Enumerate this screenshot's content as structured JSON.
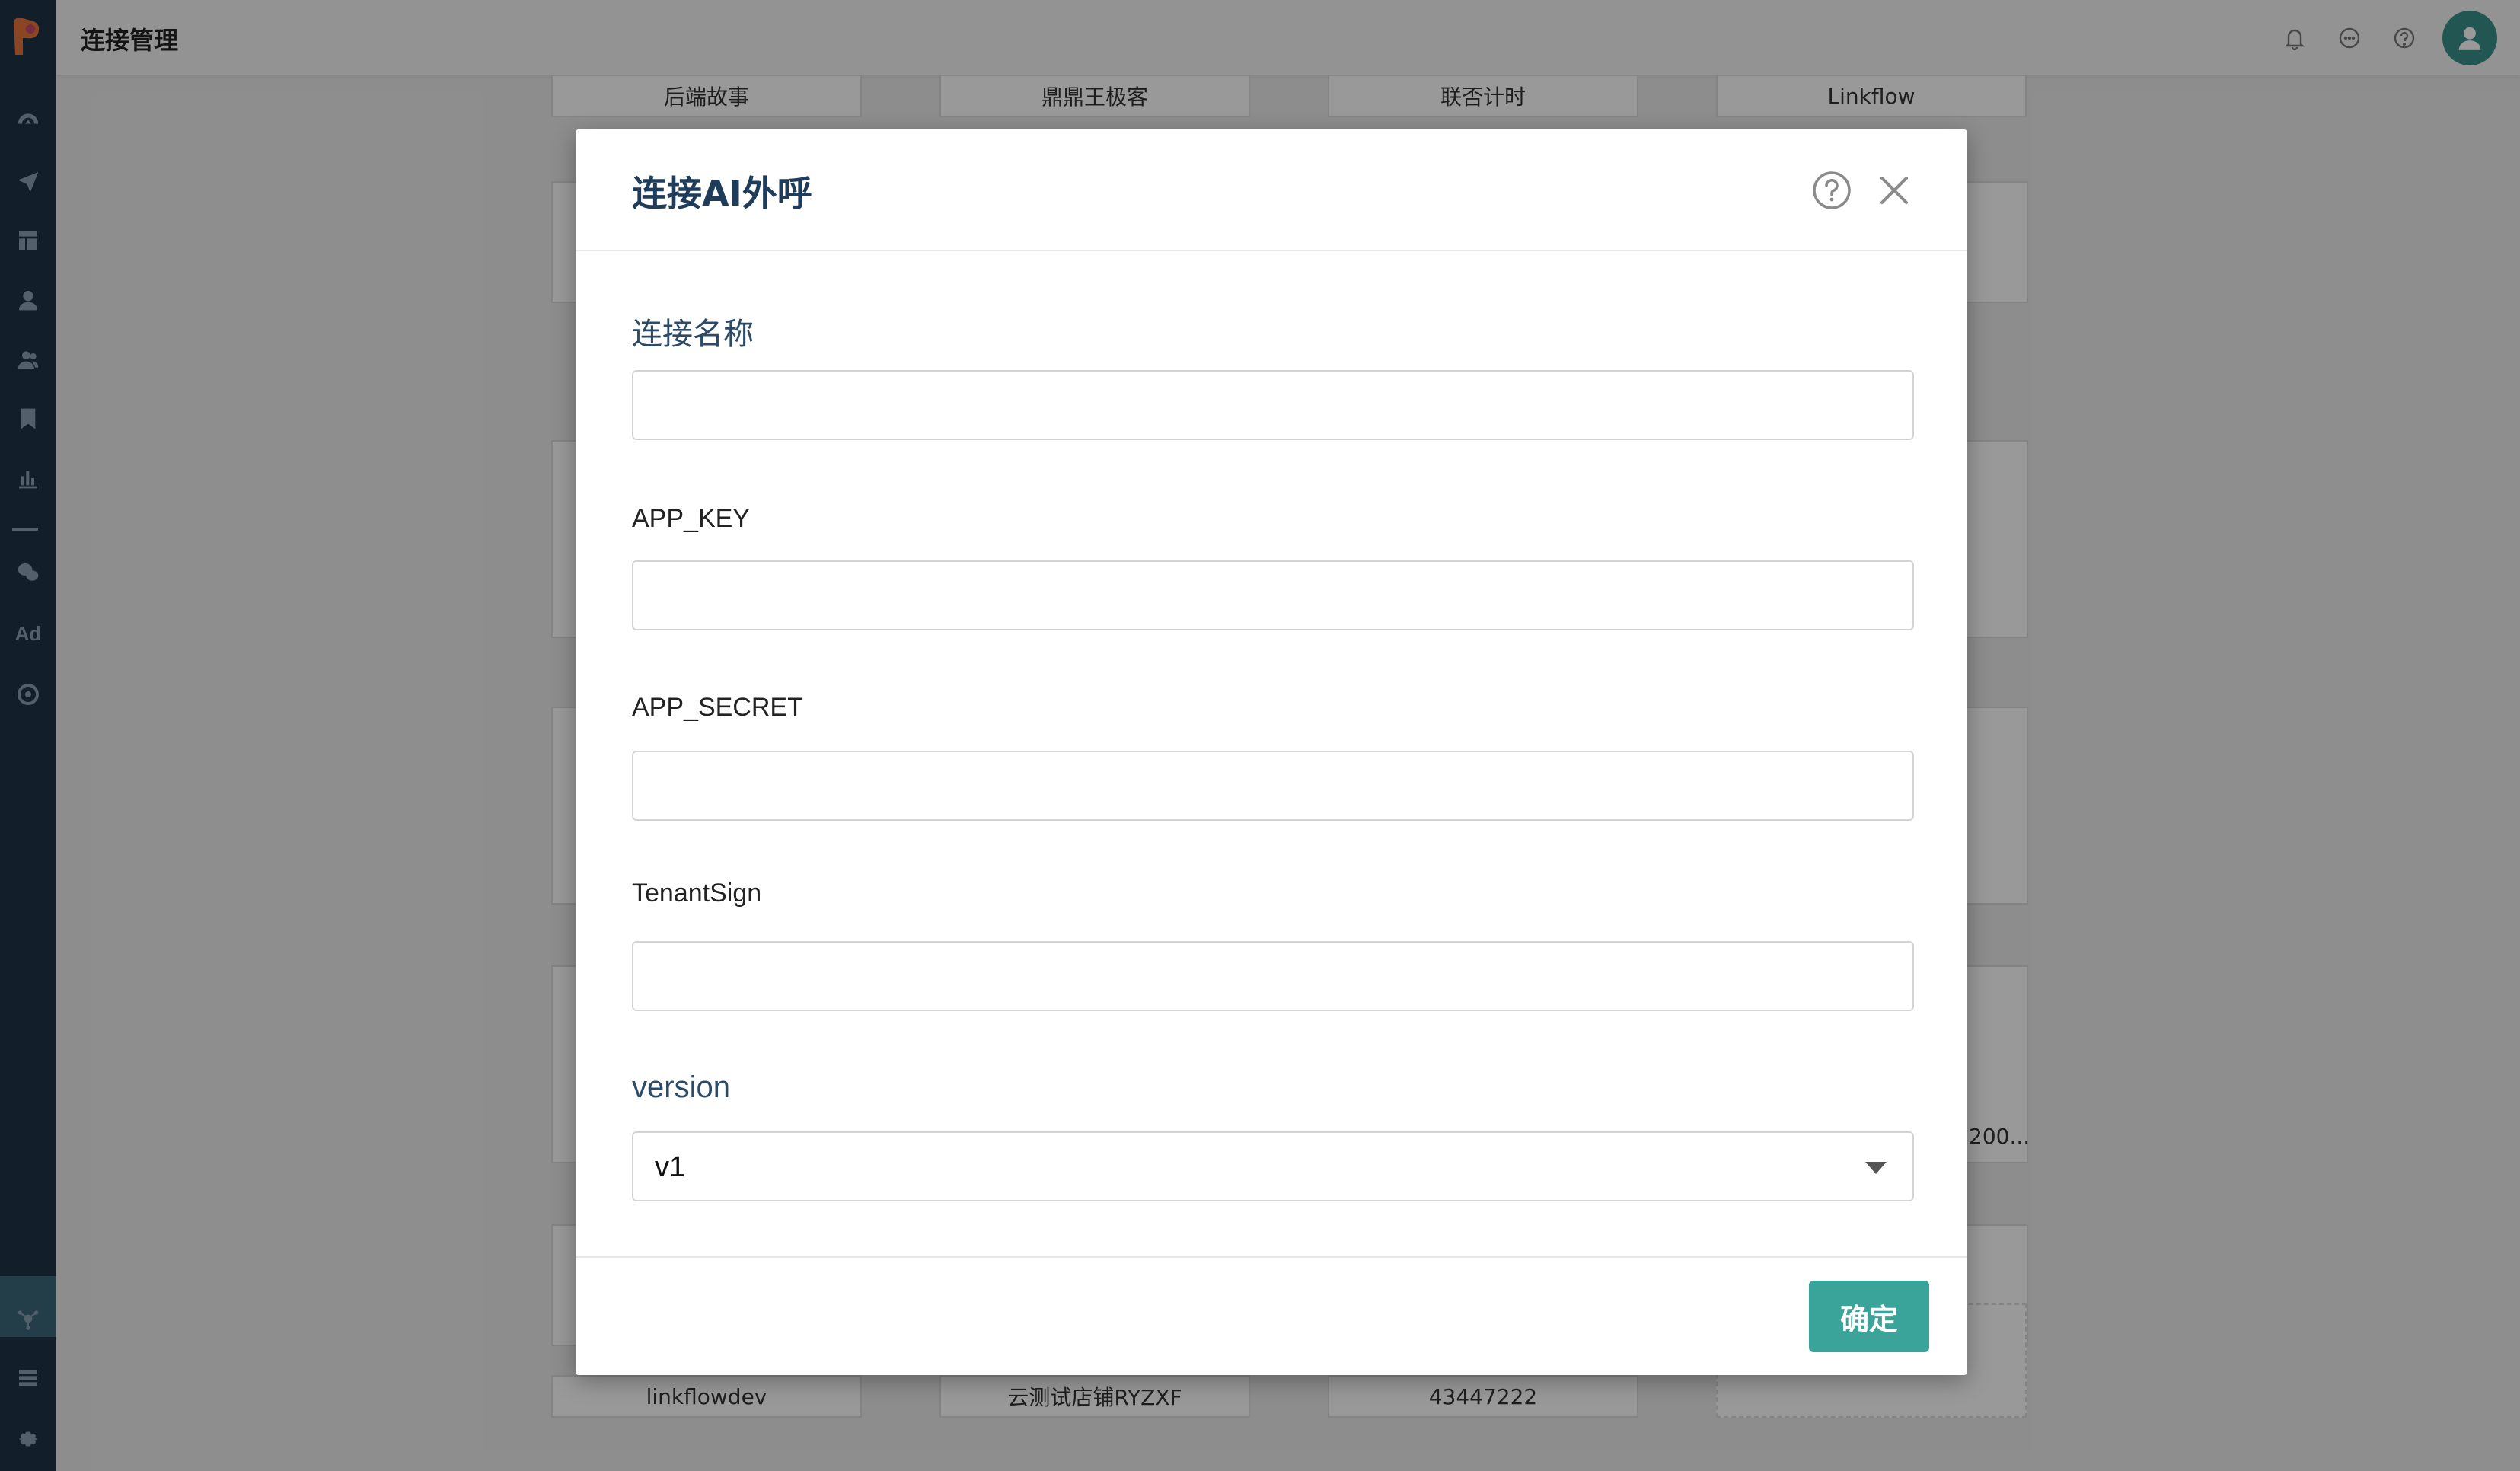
{
  "header": {
    "title": "连接管理",
    "icons": [
      "bell-icon",
      "message-icon",
      "help-icon",
      "user-avatar"
    ]
  },
  "sidebar": {
    "icons": [
      "dashboard-icon",
      "send-icon",
      "layout-icon",
      "user-icon",
      "users-icon",
      "bookmark-icon",
      "bar-chart-icon",
      "wechat-icon",
      "ad-icon",
      "target-icon",
      "connection-icon",
      "list-icon",
      "settings-icon"
    ],
    "ad_label": "Ad"
  },
  "background": {
    "top_tabs": [
      "后端故事",
      "鼎鼎王极客",
      "联否计时",
      "Linkflow"
    ],
    "bottom_tabs": [
      "linkflowdev",
      "云测试店铺RYZXF",
      "43447222"
    ],
    "partial_text": "200..."
  },
  "modal": {
    "title": "连接AI外呼",
    "fields": [
      {
        "label": "连接名称",
        "value": "",
        "placeholder": ""
      },
      {
        "label": "APP_KEY",
        "value": "",
        "placeholder": ""
      },
      {
        "label": "APP_SECRET",
        "value": "",
        "placeholder": ""
      },
      {
        "label": "TenantSign",
        "value": "",
        "placeholder": ""
      }
    ],
    "version": {
      "label": "version",
      "selected": "v1"
    },
    "confirm_label": "确定"
  },
  "colors": {
    "sidebar_bg": "#1e3448",
    "accent": "#3aa39a",
    "title_color": "#1f3d5a"
  }
}
